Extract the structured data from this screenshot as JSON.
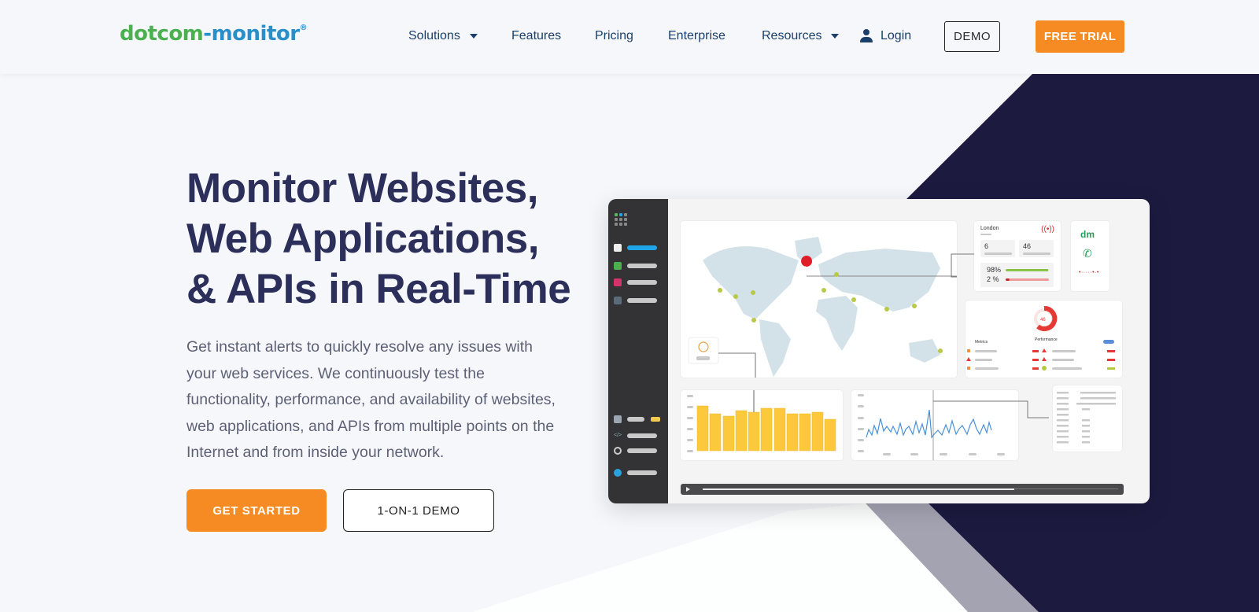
{
  "header": {
    "logo": {
      "part1": "dotcom",
      "part2": "-monitor",
      "mark": "®"
    },
    "nav": [
      {
        "label": "Solutions",
        "has_dropdown": true
      },
      {
        "label": "Features",
        "has_dropdown": false
      },
      {
        "label": "Pricing",
        "has_dropdown": false
      },
      {
        "label": "Enterprise",
        "has_dropdown": false
      },
      {
        "label": "Resources",
        "has_dropdown": true
      }
    ],
    "login_label": "Login",
    "demo_label": "DEMO",
    "free_trial_label": "FREE TRIAL"
  },
  "hero": {
    "title_lines": [
      "Monitor Websites,",
      "Web Applications,",
      "& APIs in Real-Time"
    ],
    "description": "Get instant alerts to quickly resolve any issues with your web services. We continuously test the functionality, performance, and availability of websites, web applications, and APIs from multiple points on the Internet and from inside your network.",
    "get_started_label": "GET STARTED",
    "demo_label": "1-ON-1 DEMO"
  },
  "dashboard": {
    "location_card": {
      "city": "London",
      "stat1": "6",
      "stat2": "46",
      "uptime": "98%",
      "downtime": "2 %",
      "uptime_fraction": 0.98,
      "downtime_fraction": 0.02
    },
    "brand_card": {
      "logo": "dm"
    },
    "performance_card": {
      "score": "46",
      "metrics_label": "Metrics",
      "performance_label": "Performance"
    },
    "player_progress": 0.75
  },
  "colors": {
    "brand_orange": "#f68b24",
    "brand_green": "#4caf50",
    "brand_blue": "#2a8fc9",
    "navy": "#1c1a3f",
    "nav_text": "#1b3f6b",
    "title_text": "#2b2f5a"
  }
}
